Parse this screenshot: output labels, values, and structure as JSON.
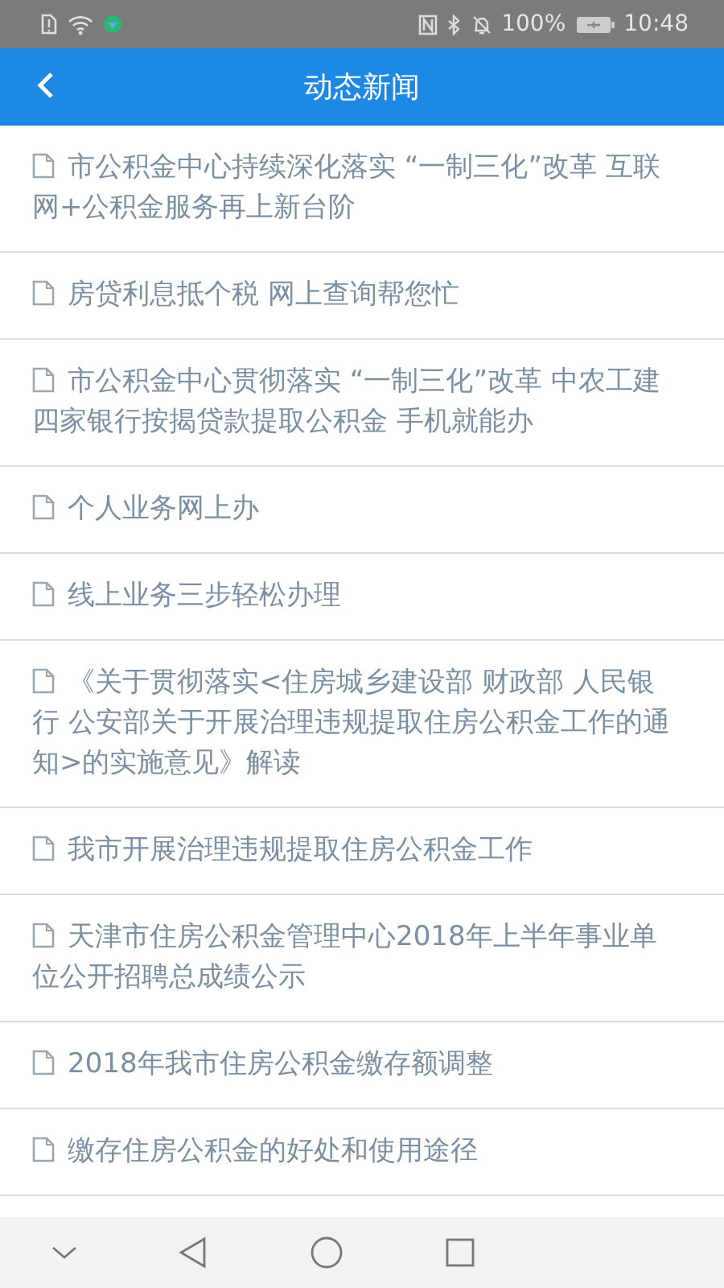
{
  "status_bar": {
    "battery_text": "100%",
    "time": "10:48"
  },
  "header": {
    "title": "动态新闻"
  },
  "news": [
    {
      "title": "市公积金中心持续深化落实 “一制三化”改革 互联网+公积金服务再上新台阶"
    },
    {
      "title": "房贷利息抵个税 网上查询帮您忙"
    },
    {
      "title": "市公积金中心贯彻落实 “一制三化”改革 中农工建四家银行按揭贷款提取公积金 手机就能办"
    },
    {
      "title": "个人业务网上办"
    },
    {
      "title": "线上业务三步轻松办理"
    },
    {
      "title": "《关于贯彻落实<住房城乡建设部 财政部 人民银行 公安部关于开展治理违规提取住房公积金工作的通知>的实施意见》解读"
    },
    {
      "title": "我市开展治理违规提取住房公积金工作"
    },
    {
      "title": "天津市住房公积金管理中心2018年上半年事业单位公开招聘总成绩公示"
    },
    {
      "title": "2018年我市住房公积金缴存额调整"
    },
    {
      "title": "缴存住房公积金的好处和使用途径"
    }
  ]
}
